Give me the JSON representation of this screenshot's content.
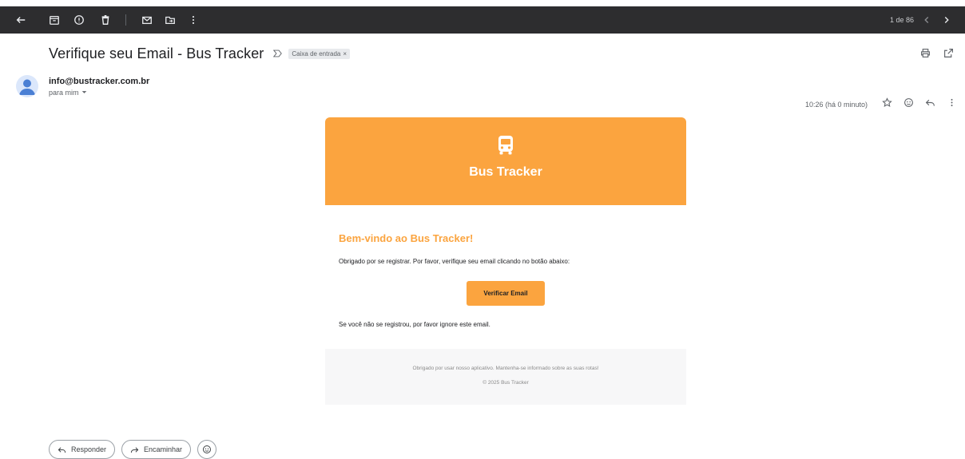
{
  "toolbar": {
    "icons": [
      "back-arrow-icon",
      "archive-icon",
      "report-spam-icon",
      "delete-icon",
      "mark-unread-icon",
      "move-to-icon",
      "more-vert-icon"
    ],
    "pager_text": "1 de 86"
  },
  "message": {
    "subject": "Verifique seu Email - Bus Tracker",
    "label": "Caixa de entrada",
    "sender_email": "info@bustracker.com.br",
    "recipient": "para mim",
    "time": "10:26 (há 0 minuto)"
  },
  "email_card": {
    "accent_color": "#fba43f",
    "brand": "Bus Tracker",
    "welcome": "Bem-vindo ao Bus Tracker!",
    "intro": "Obrigado por se registrar. Por favor, verifique seu email clicando no botão abaixo:",
    "verify_button": "Verificar Email",
    "ignore_note": "Se você não se registrou, por favor ignore este email.",
    "footer_thanks": "Obrigado por usar nosso aplicativo. Mantenha-se informado sobre as suas rotas!",
    "footer_copyright": "© 2025 Bus Tracker"
  },
  "actions": {
    "reply": "Responder",
    "forward": "Encaminhar"
  }
}
